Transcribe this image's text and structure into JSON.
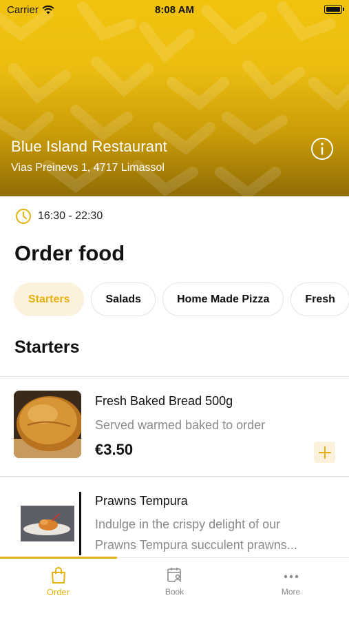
{
  "status_bar": {
    "carrier": "Carrier",
    "time": "8:08 AM"
  },
  "restaurant": {
    "name": "Blue Island Restaurant",
    "address": "Vias Preinevs 1, 4717 Limassol",
    "hours": "16:30 - 22:30"
  },
  "page_title": "Order food",
  "categories": [
    {
      "label": "Starters",
      "active": true
    },
    {
      "label": "Salads"
    },
    {
      "label": "Home Made Pizza"
    },
    {
      "label": "Fresh"
    }
  ],
  "section_title": "Starters",
  "items": [
    {
      "name": "Fresh Baked Bread 500g",
      "description": "Served warmed baked to order",
      "price": "€3.50",
      "add_label": "+"
    },
    {
      "name": "Prawns Tempura",
      "description_line1": "Indulge in the crispy delight of our",
      "description_line2": "Prawns Tempura succulent prawns..."
    }
  ],
  "tabs": [
    {
      "label": "Order",
      "icon": "bag-icon",
      "active": true
    },
    {
      "label": "Book",
      "icon": "calendar-person-icon"
    },
    {
      "label": "More",
      "icon": "more-dots-icon"
    }
  ],
  "colors": {
    "accent": "#e7b10c",
    "header": "#f1c30e",
    "chip_active_bg": "#fbf1dc"
  }
}
